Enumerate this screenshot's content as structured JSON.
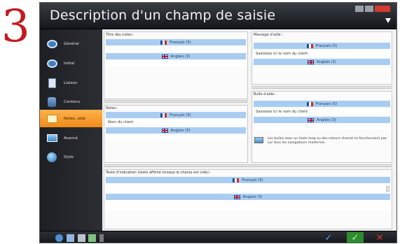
{
  "step_number": "3",
  "window": {
    "title": "Description d'un champ de saisie"
  },
  "sidebar": {
    "items": [
      {
        "label": "Général",
        "icon": "circle-icon"
      },
      {
        "label": "Initial",
        "icon": "circle-icon"
      },
      {
        "label": "Liaison",
        "icon": "document-icon"
      },
      {
        "label": "Contenu",
        "icon": "database-icon"
      },
      {
        "label": "Notes, aide",
        "icon": "edit-icon"
      },
      {
        "label": "Avancé",
        "icon": "image-icon"
      },
      {
        "label": "Style",
        "icon": "globe-icon"
      }
    ],
    "active_index": 4
  },
  "panels": {
    "titre_notes": {
      "label": "Titre des notes :",
      "lang_fr": "Français (5)",
      "lang_en": "Anglais (3)"
    },
    "notes": {
      "label": "Notes :",
      "lang_fr": "Français (5)",
      "value": "Nom du client",
      "lang_en": "Anglais (3)"
    },
    "message_aide": {
      "label": "Message d'aide :",
      "lang_fr": "Français (5)",
      "value": "Saisissez ici le nom du client",
      "lang_en": "Anglais (3)"
    },
    "bulle_aide": {
      "label": "Bulle d'aide :",
      "lang_fr": "Français (5)",
      "value": "Saisissez ici le nom du client",
      "lang_en": "Anglais (3)",
      "info": "Les bulles avec un texte long ou des retours chariot ne fonctionnent pas sur tous les navigateurs modernes."
    },
    "texte_indication": {
      "label": "Texte d'indication (texte affiché lorsque le champ est vide) :",
      "lang_fr": "Français (5)",
      "lang_en": "Anglais (3)"
    }
  },
  "colors": {
    "accent": "#f29a1f",
    "row_blue": "#a9cdf0",
    "step_number": "#c41a1f"
  }
}
